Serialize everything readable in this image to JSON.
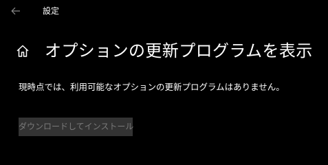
{
  "window": {
    "title": "設定",
    "back_icon": "arrow-left-icon"
  },
  "header": {
    "icon": "home-icon",
    "title": "オプションの更新プログラムを表示"
  },
  "main": {
    "status_text": "現時点では、利用可能なオプションの更新プログラムはありません。",
    "install_button": {
      "label": "ダウンロードしてインストール",
      "enabled": false
    }
  },
  "colors": {
    "background": "#000000",
    "text": "#ffffff",
    "disabled_button_bg": "#333333",
    "disabled_button_text": "#7a7a7a",
    "back_arrow": "#8a8a8a"
  }
}
